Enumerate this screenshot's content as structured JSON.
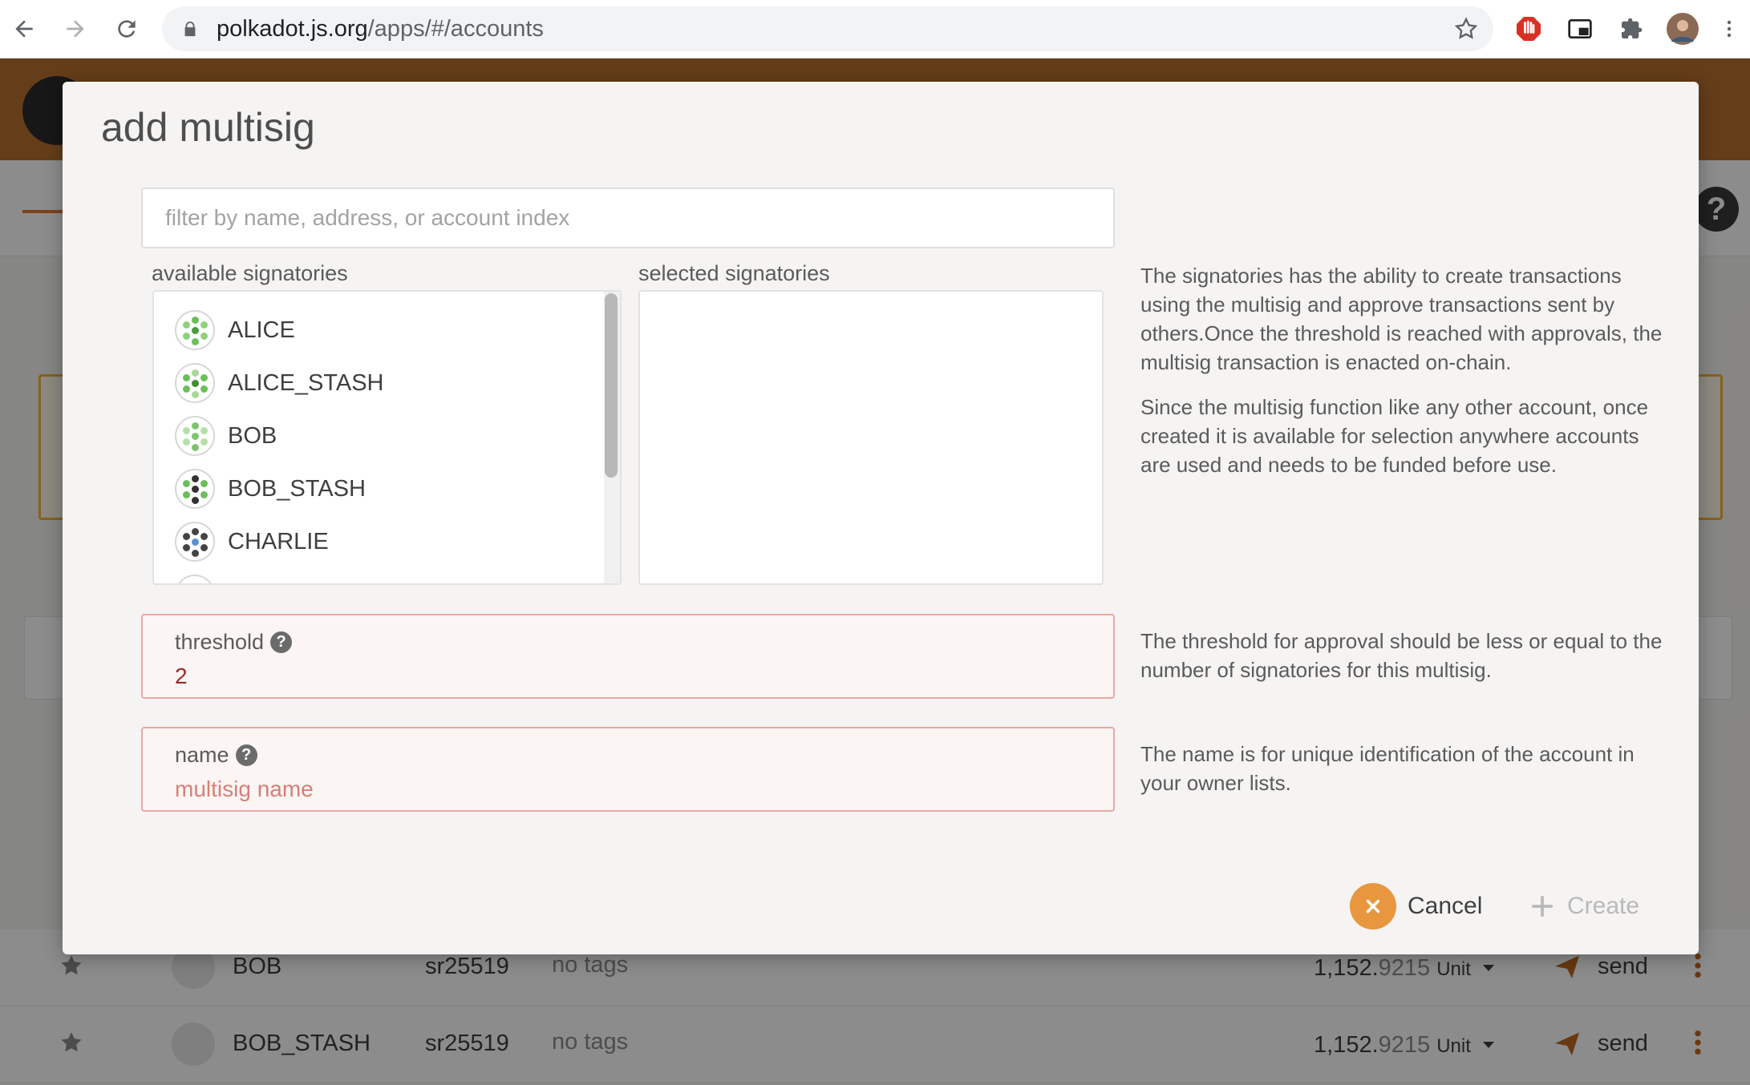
{
  "browser": {
    "url_host": "polkadot.js.org",
    "url_path": "/apps/#/accounts"
  },
  "background": {
    "rows": [
      {
        "name": "BOB",
        "type": "sr25519",
        "tags": "no tags",
        "balance_int": "1,152.",
        "balance_frac": "9215",
        "unit": "Unit",
        "send": "send"
      },
      {
        "name": "BOB_STASH",
        "type": "sr25519",
        "tags": "no tags",
        "balance_int": "1,152.",
        "balance_frac": "9215",
        "unit": "Unit",
        "send": "send"
      }
    ]
  },
  "modal": {
    "title": "add multisig",
    "filter_placeholder": "filter by name, address, or account index",
    "available_label": "available signatories",
    "selected_label": "selected signatories",
    "available": [
      {
        "name": "ALICE"
      },
      {
        "name": "ALICE_STASH"
      },
      {
        "name": "BOB"
      },
      {
        "name": "BOB_STASH"
      },
      {
        "name": "CHARLIE"
      }
    ],
    "selected": [],
    "help_signatories_1": "The signatories has the ability to create transactions using the multisig and approve transactions sent by others.Once the threshold is reached with approvals, the multisig transaction is enacted on-chain.",
    "help_signatories_2": "Since the multisig function like any other account, once created it is available for selection anywhere accounts are used and needs to be funded before use.",
    "threshold_label": "threshold",
    "threshold_value": "2",
    "help_threshold": "The threshold for approval should be less or equal to the number of signatories for this multisig.",
    "name_label": "name",
    "name_placeholder": "multisig name",
    "help_name": "The name is for unique identification of the account in your owner lists.",
    "cancel_label": "Cancel",
    "create_label": "Create"
  },
  "colors": {
    "accent": "#e8973f",
    "header": "#b8702e",
    "error_border": "#e8a8a3",
    "error_text": "#9b2b25"
  }
}
